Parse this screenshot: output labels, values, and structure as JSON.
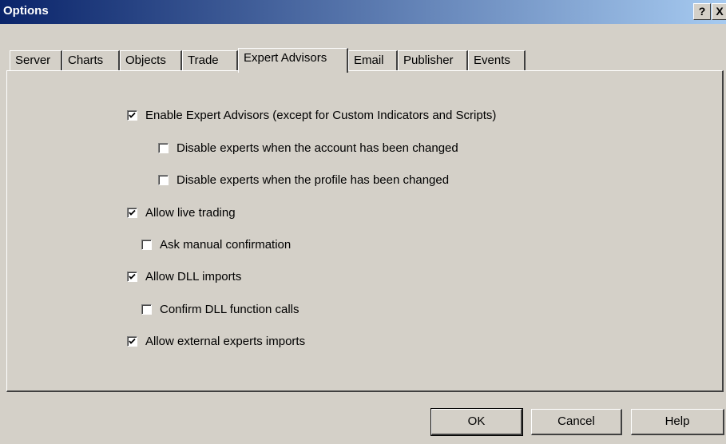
{
  "window": {
    "title": "Options",
    "help_btn": "?",
    "close_btn": "X"
  },
  "tabs": [
    {
      "label": "Server"
    },
    {
      "label": "Charts"
    },
    {
      "label": "Objects"
    },
    {
      "label": "Trade"
    },
    {
      "label": "Expert Advisors"
    },
    {
      "label": "Email"
    },
    {
      "label": "Publisher"
    },
    {
      "label": "Events"
    }
  ],
  "active_tab": "Expert Advisors",
  "options": [
    {
      "label": "Enable Expert Advisors (except for Custom Indicators and Scripts)",
      "checked": true
    },
    {
      "label": "Disable experts when the account has been changed",
      "checked": false
    },
    {
      "label": "Disable experts when the profile has been changed",
      "checked": false
    },
    {
      "label": "Allow live trading",
      "checked": true
    },
    {
      "label": "Ask manual confirmation",
      "checked": false
    },
    {
      "label": "Allow DLL imports",
      "checked": true
    },
    {
      "label": "Confirm DLL function calls",
      "checked": false
    },
    {
      "label": "Allow external experts imports",
      "checked": true
    }
  ],
  "buttons": {
    "ok": "OK",
    "cancel": "Cancel",
    "help": "Help"
  }
}
